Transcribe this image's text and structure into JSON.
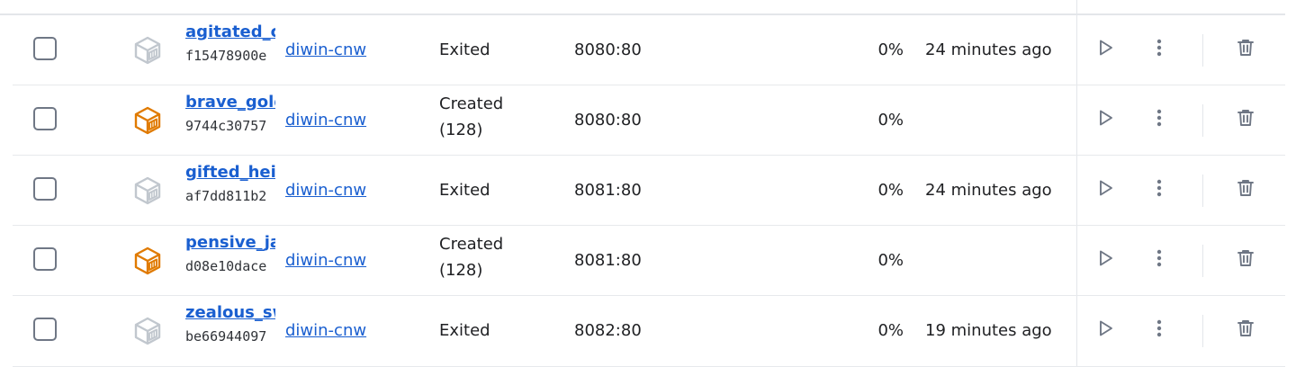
{
  "containers": [
    {
      "name": "agitated_c",
      "id": "f15478900e",
      "image": "diwin-cnw",
      "status_line1": "Exited",
      "status_line2": "",
      "ports": "8080:80",
      "cpu": "0%",
      "last_started": "24 minutes ago",
      "running_state": "stopped",
      "cube_color": "#c1c7ce"
    },
    {
      "name": "brave_gold",
      "id": "9744c30757",
      "image": "diwin-cnw",
      "status_line1": "Created",
      "status_line2": "(128)",
      "ports": "8080:80",
      "cpu": "0%",
      "last_started": "",
      "running_state": "created",
      "cube_color": "#e07a00"
    },
    {
      "name": "gifted_heis",
      "id": "af7dd811b2",
      "image": "diwin-cnw",
      "status_line1": "Exited",
      "status_line2": "",
      "ports": "8081:80",
      "cpu": "0%",
      "last_started": "24 minutes ago",
      "running_state": "stopped",
      "cube_color": "#c1c7ce"
    },
    {
      "name": "pensive_ja",
      "id": "d08e10dace",
      "image": "diwin-cnw",
      "status_line1": "Created",
      "status_line2": "(128)",
      "ports": "8081:80",
      "cpu": "0%",
      "last_started": "",
      "running_state": "created",
      "cube_color": "#e07a00"
    },
    {
      "name": "zealous_sw",
      "id": "be66944097",
      "image": "diwin-cnw",
      "status_line1": "Exited",
      "status_line2": "",
      "ports": "8082:80",
      "cpu": "0%",
      "last_started": "19 minutes ago",
      "running_state": "stopped",
      "cube_color": "#c1c7ce"
    }
  ],
  "icons": {
    "container": "container-cube-icon",
    "start": "play-icon",
    "more": "kebab-menu-icon",
    "delete": "trash-icon"
  },
  "colors": {
    "link": "#1a5fd0",
    "icon": "#6f7785",
    "cube_stopped": "#c1c7ce",
    "cube_created": "#e07a00",
    "divider": "#e3e6ea"
  }
}
